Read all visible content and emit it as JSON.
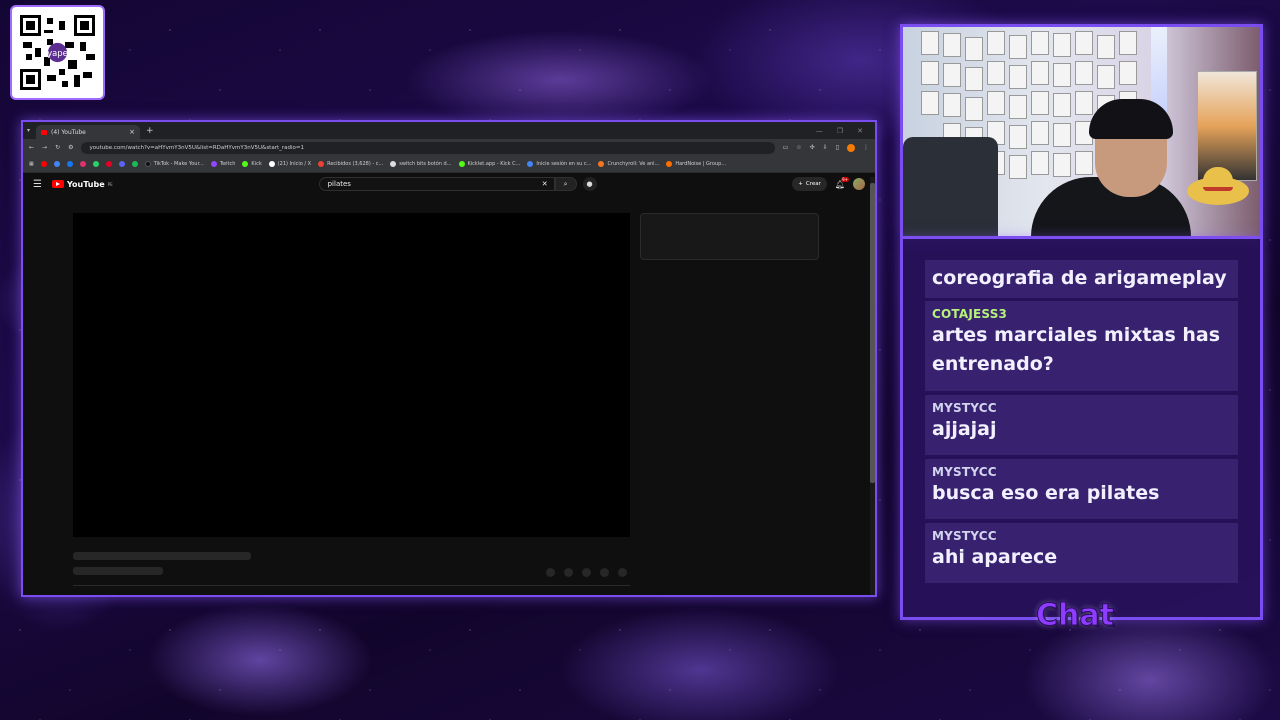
{
  "overlay": {
    "qr_logo": "yape",
    "chat_title": "Chat"
  },
  "browser": {
    "tab": {
      "title": "(4) YouTube",
      "close": "×",
      "new_tab": "+"
    },
    "address": {
      "url": "youtube.com/watch?v=aHYvmY3nV5U&list=RDaHYvmY3nV5U&start_radio=1"
    },
    "bookmarks": [
      {
        "label": "TikTok - Make Your...",
        "color": "#111111"
      },
      {
        "label": "Twitch",
        "color": "#9146ff"
      },
      {
        "label": "Kick",
        "color": "#53fc18"
      },
      {
        "label": "(21) Inicio / X",
        "color": "#ffffff"
      },
      {
        "label": "Recibidos (3,628) - c...",
        "color": "#ea4335"
      },
      {
        "label": "switch bits botón d...",
        "color": "#dddddd"
      },
      {
        "label": "Kicklet.app - Kick C...",
        "color": "#53fc18"
      },
      {
        "label": "Inicie sesión en su c...",
        "color": "#4285f4"
      },
      {
        "label": "Crunchyroll: Ve ani...",
        "color": "#f47521"
      },
      {
        "label": "HardNoise | Group...",
        "color": "#ff6f00"
      }
    ]
  },
  "youtube": {
    "logo_text": "YouTube",
    "logo_region": "PE",
    "search_value": "pilates",
    "create_label": "Crear",
    "notifications_badge": "9+"
  },
  "chat": {
    "messages": [
      {
        "user": "",
        "text": "coreografia de arigameplay",
        "user_color": "#ffffff"
      },
      {
        "user": "COTAJESS3",
        "text": "artes marciales mixtas has entrenado?",
        "user_color": "#b6f27a"
      },
      {
        "user": "MYSTYCC",
        "text": "ajjajaj",
        "user_color": "#d2d4f0"
      },
      {
        "user": "MYSTYCC",
        "text": "busca eso era pilates",
        "user_color": "#d2d4f0"
      },
      {
        "user": "MYSTYCC",
        "text": "ahi aparece",
        "user_color": "#d2d4f0"
      }
    ]
  },
  "colors": {
    "frame_accent": "#7a4df0",
    "youtube_red": "#ff0000",
    "chat_title": "#8e3cff"
  }
}
